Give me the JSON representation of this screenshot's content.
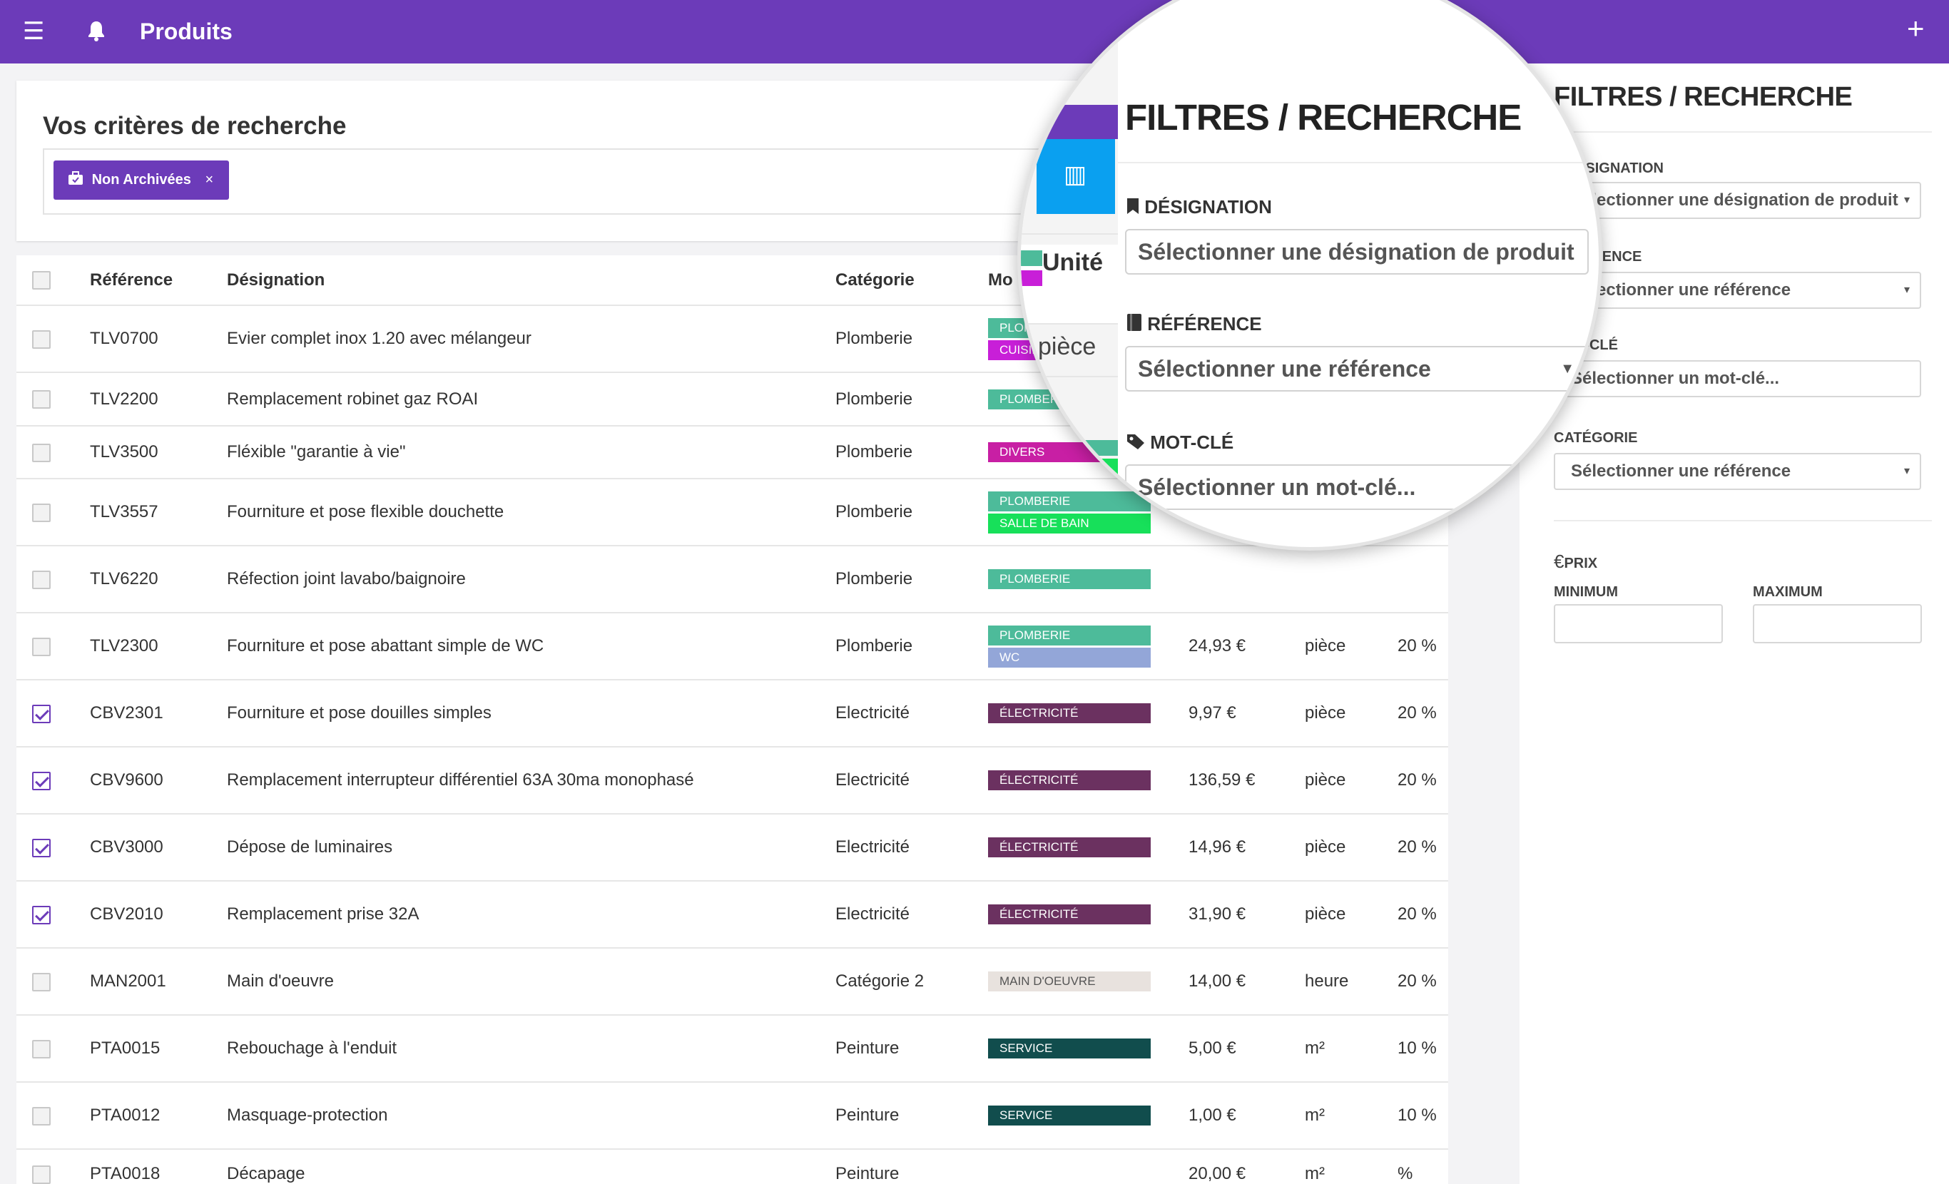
{
  "header": {
    "title": "Produits",
    "menu_icon": "hamburger-menu-icon",
    "bell_icon": "bell-icon",
    "add_icon": "plus-icon",
    "color": "#6c3bb9"
  },
  "criteria": {
    "title": "Vos critères de recherche",
    "chip_label": "Non Archivées",
    "chip_remove": "×"
  },
  "table": {
    "columns": [
      "Référence",
      "Désignation",
      "Catégorie",
      "Mo"
    ],
    "rows": [
      {
        "checked": false,
        "ref": "TLV0700",
        "designation": "Evier complet inox 1.20 avec mélangeur",
        "category": "Plomberie",
        "tags": [
          {
            "label": "PLOMBERIE",
            "color": "#4dbb9a"
          },
          {
            "label": "CUISINE",
            "color": "#c81fd8"
          }
        ],
        "price": "",
        "unit": "",
        "tva": ""
      },
      {
        "checked": false,
        "ref": "TLV2200",
        "designation": "Remplacement robinet gaz ROAI",
        "category": "Plomberie",
        "tags": [
          {
            "label": "PLOMBERIE",
            "color": "#4dbb9a"
          }
        ],
        "price": "",
        "unit": "",
        "tva": ""
      },
      {
        "checked": false,
        "ref": "TLV3500",
        "designation": "Fléxible \"garantie à vie\"",
        "category": "Plomberie",
        "tags": [
          {
            "label": "DIVERS",
            "color": "#c81fa4"
          }
        ],
        "price": "",
        "unit": "",
        "tva": ""
      },
      {
        "checked": false,
        "ref": "TLV3557",
        "designation": "Fourniture et pose flexible douchette",
        "category": "Plomberie",
        "tags": [
          {
            "label": "PLOMBERIE",
            "color": "#4dbb9a"
          },
          {
            "label": "SALLE DE BAIN",
            "color": "#17e05a"
          }
        ],
        "price": "",
        "unit": "",
        "tva": ""
      },
      {
        "checked": false,
        "ref": "TLV6220",
        "designation": "Réfection joint lavabo/baignoire",
        "category": "Plomberie",
        "tags": [
          {
            "label": "PLOMBERIE",
            "color": "#4dbb9a"
          }
        ],
        "price": "",
        "unit": "",
        "tva": ""
      },
      {
        "checked": false,
        "ref": "TLV2300",
        "designation": "Fourniture et pose abattant simple de WC",
        "category": "Plomberie",
        "tags": [
          {
            "label": "PLOMBERIE",
            "color": "#4dbb9a"
          },
          {
            "label": "WC",
            "color": "#93a6d8"
          }
        ],
        "price": "24,93 €",
        "unit": "pièce",
        "tva": "20 %"
      },
      {
        "checked": true,
        "ref": "CBV2301",
        "designation": "Fourniture et pose douilles simples",
        "category": "Electricité",
        "tags": [
          {
            "label": "ÉLECTRICITÉ",
            "color": "#6b3160"
          }
        ],
        "price": "9,97 €",
        "unit": "pièce",
        "tva": "20 %"
      },
      {
        "checked": true,
        "ref": "CBV9600",
        "designation": "Remplacement interrupteur différentiel 63A 30ma monophasé",
        "category": "Electricité",
        "tags": [
          {
            "label": "ÉLECTRICITÉ",
            "color": "#6b3160"
          }
        ],
        "price": "136,59 €",
        "unit": "pièce",
        "tva": "20 %"
      },
      {
        "checked": true,
        "ref": "CBV3000",
        "designation": "Dépose de luminaires",
        "category": "Electricité",
        "tags": [
          {
            "label": "ÉLECTRICITÉ",
            "color": "#6b3160"
          }
        ],
        "price": "14,96 €",
        "unit": "pièce",
        "tva": "20 %"
      },
      {
        "checked": true,
        "ref": "CBV2010",
        "designation": "Remplacement prise 32A",
        "category": "Electricité",
        "tags": [
          {
            "label": "ÉLECTRICITÉ",
            "color": "#6b3160"
          }
        ],
        "price": "31,90 €",
        "unit": "pièce",
        "tva": "20 %"
      },
      {
        "checked": false,
        "ref": "MAN2001",
        "designation": "Main d'oeuvre",
        "category": "Catégorie 2",
        "tags": [
          {
            "label": "MAIN D'OEUVRE",
            "color": "#e8e2de",
            "text": "#555555"
          }
        ],
        "price": "14,00 €",
        "unit": "heure",
        "tva": "20 %"
      },
      {
        "checked": false,
        "ref": "PTA0015",
        "designation": "Rebouchage à l'enduit",
        "category": "Peinture",
        "tags": [
          {
            "label": "SERVICE",
            "color": "#114d4d"
          }
        ],
        "price": "5,00 €",
        "unit": "m²",
        "tva": "10 %"
      },
      {
        "checked": false,
        "ref": "PTA0012",
        "designation": "Masquage-protection",
        "category": "Peinture",
        "tags": [
          {
            "label": "SERVICE",
            "color": "#114d4d"
          }
        ],
        "price": "1,00 €",
        "unit": "m²",
        "tva": "10 %"
      },
      {
        "checked": false,
        "ref": "PTA0018",
        "designation": "Décapage",
        "category": "Peinture",
        "tags": [],
        "price": "20,00 €",
        "unit": "m²",
        "tva": "%"
      }
    ]
  },
  "filters": {
    "title": "FILTRES / RECHERCHE",
    "designation_label": "DÉSIGNATION",
    "designation_placeholder": "Sélectionner une désignation de produit",
    "reference_label": "RÉFÉRENCE",
    "reference_placeholder": "Sélectionner une référence",
    "keyword_label": "MOT-CLÉ",
    "keyword_placeholder": "Sélectionner un mot-clé...",
    "category_label": "CATÉGORIE",
    "category_placeholder": "Sélectionner une référence",
    "price_label": "PRIX",
    "price_symbol": "€",
    "min_label": "MINIMUM",
    "max_label": "MAXIMUM"
  },
  "magnifier": {
    "peek_unit_header": "Unité",
    "peek_unit_value": "pièce"
  }
}
